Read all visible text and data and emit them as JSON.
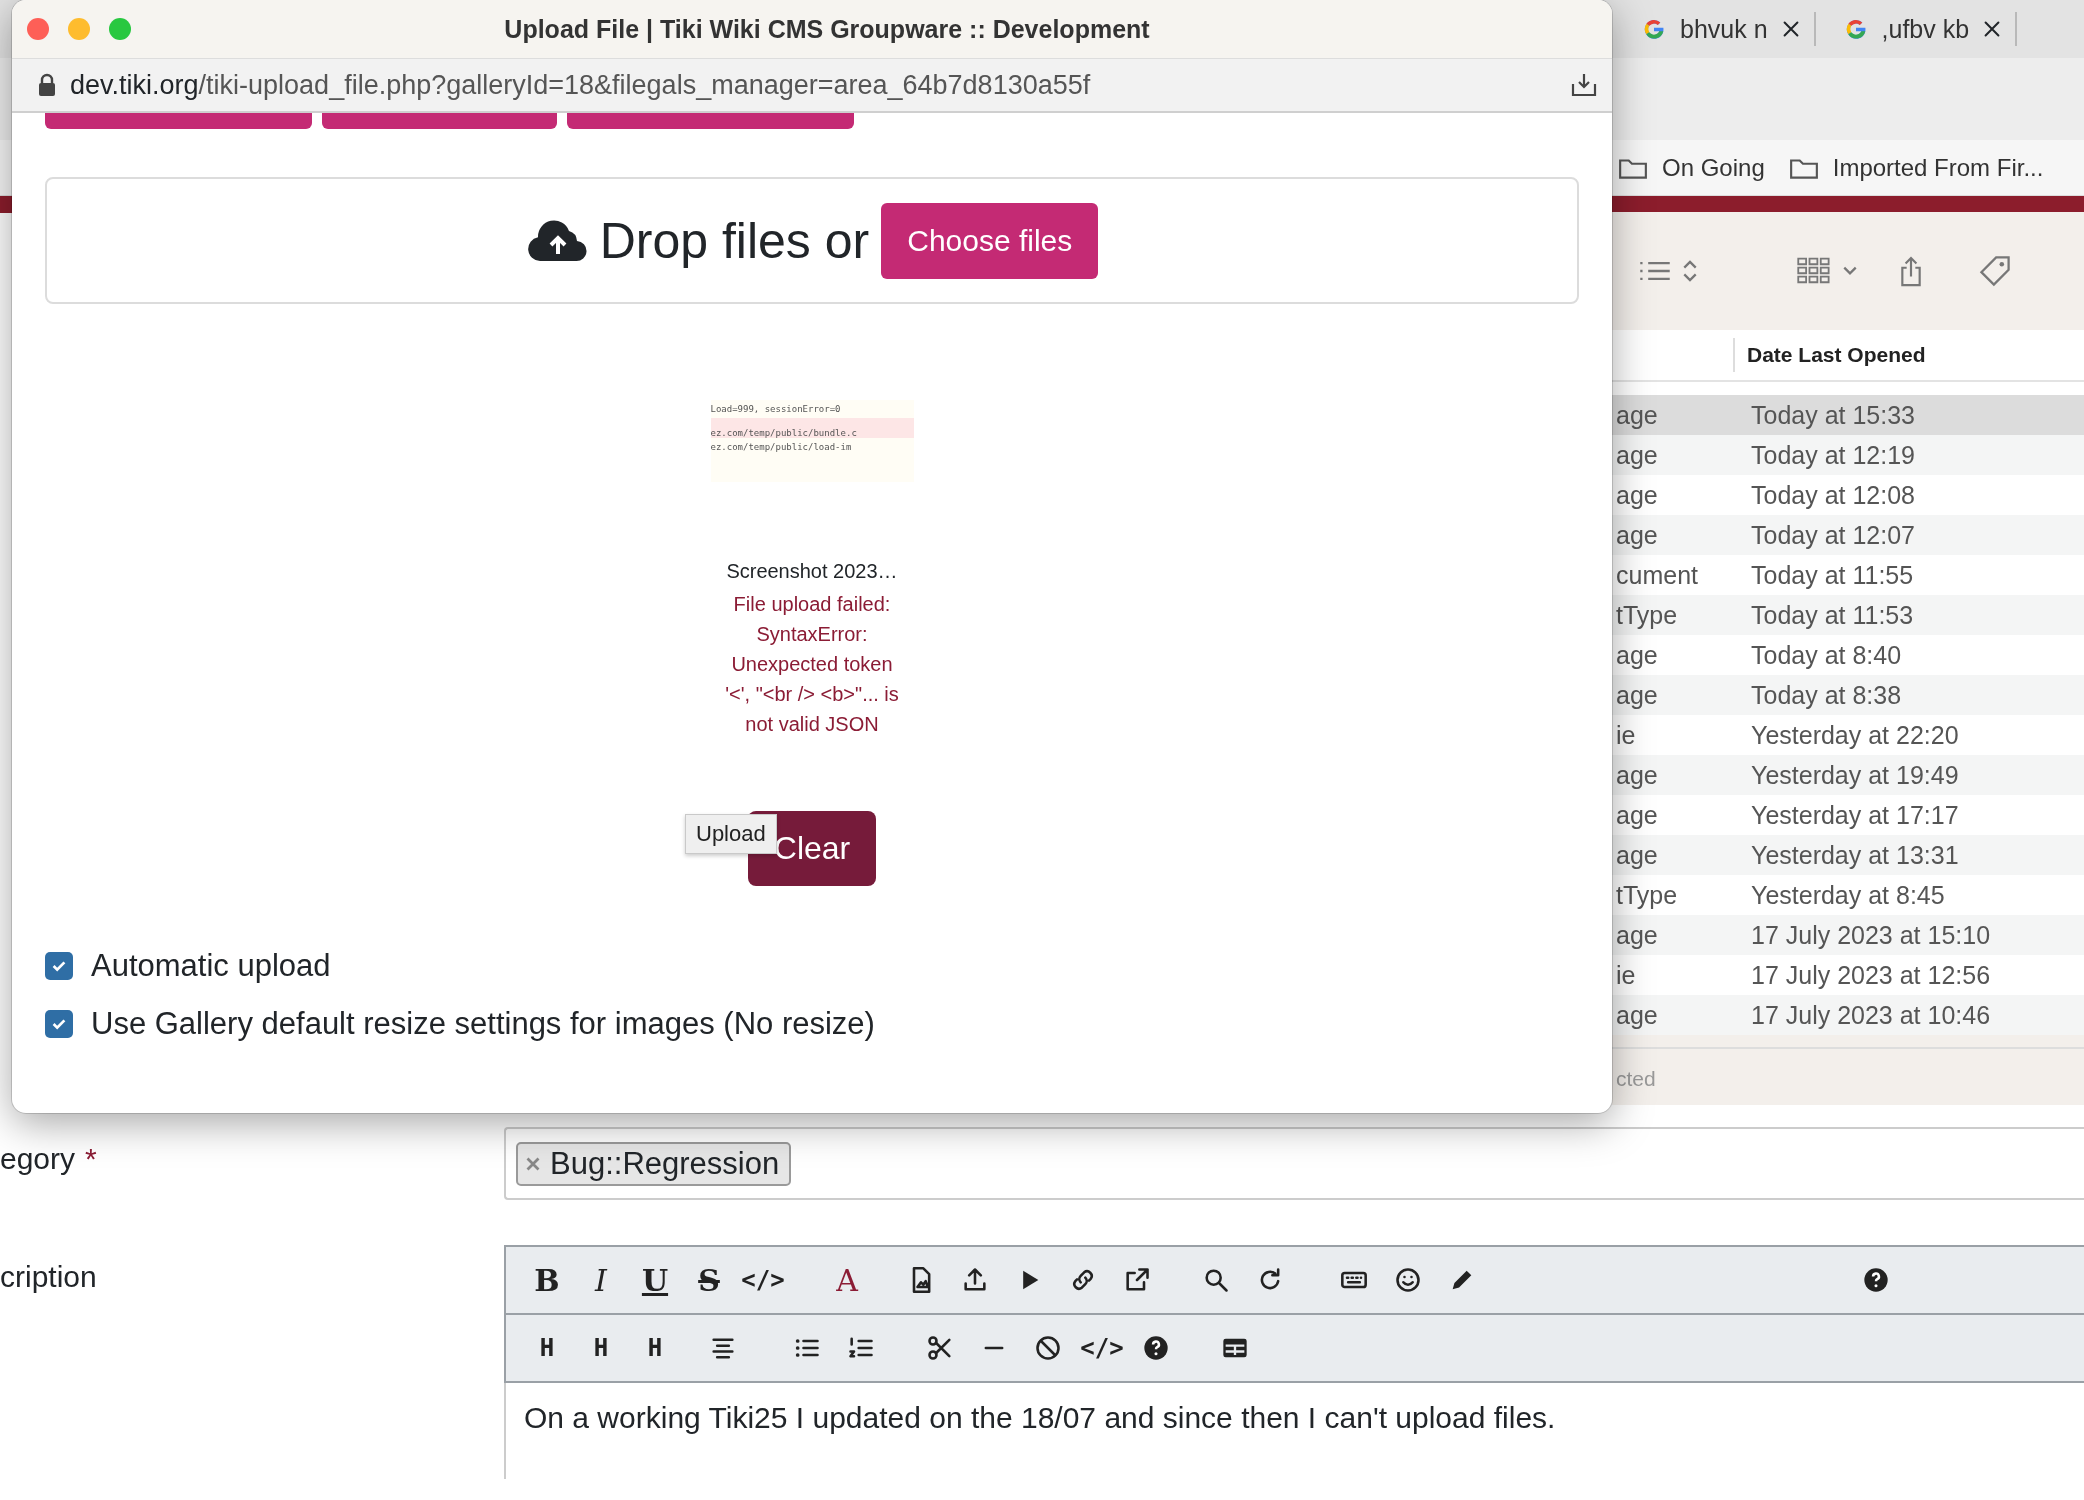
{
  "popup": {
    "title": "Upload File | Tiki Wiki CMS Groupware :: Development",
    "url_host": "dev.tiki.org",
    "url_path": "/tiki-upload_file.php?galleryId=18&filegals_manager=area_64b7d8130a55f",
    "dropzone": {
      "text": "Drop files or",
      "button": "Choose files"
    },
    "thumbnail_lines": [
      "Load=999, sessionError=0",
      "ez.com/temp/public/bundle.c",
      "ez.com/temp/public/load-im"
    ],
    "file_name": "Screenshot 2023…",
    "error": "File upload failed: SyntaxError: Unexpected token '<', \"<br /> <b>\"... is not valid JSON",
    "clear_button": "Clear",
    "tooltip": "Upload",
    "options": [
      {
        "label": "Automatic upload",
        "checked": true
      },
      {
        "label": "Use Gallery default resize settings for images (No resize)",
        "checked": true
      }
    ]
  },
  "browser_tabs": [
    {
      "title": "bhvuk n"
    },
    {
      "title": ",ufbv kb"
    }
  ],
  "bookmarks": [
    "On Going",
    "Imported From Fir..."
  ],
  "finder": {
    "column_header": "Date Last Opened",
    "footer": "cted",
    "rows": [
      {
        "column_1": "age",
        "date": "Today at 15:33",
        "selected": true
      },
      {
        "column_1": "age",
        "date": "Today at 12:19",
        "selected": false
      },
      {
        "column_1": "age",
        "date": "Today at 12:08",
        "selected": false
      },
      {
        "column_1": "age",
        "date": "Today at 12:07",
        "selected": false
      },
      {
        "column_1": "cument",
        "date": "Today at 11:55",
        "selected": false
      },
      {
        "column_1": "tType",
        "date": "Today at 11:53",
        "selected": false
      },
      {
        "column_1": "age",
        "date": "Today at 8:40",
        "selected": false
      },
      {
        "column_1": "age",
        "date": "Today at 8:38",
        "selected": false
      },
      {
        "column_1": "ie",
        "date": "Yesterday at 22:20",
        "selected": false
      },
      {
        "column_1": "age",
        "date": "Yesterday at 19:49",
        "selected": false
      },
      {
        "column_1": "age",
        "date": "Yesterday at 17:17",
        "selected": false
      },
      {
        "column_1": "age",
        "date": "Yesterday at 13:31",
        "selected": false
      },
      {
        "column_1": "tType",
        "date": "Yesterday at 8:45",
        "selected": false
      },
      {
        "column_1": "age",
        "date": "17 July 2023 at 15:10",
        "selected": false
      },
      {
        "column_1": "ie",
        "date": "17 July 2023 at 12:56",
        "selected": false
      },
      {
        "column_1": "age",
        "date": "17 July 2023 at 10:46",
        "selected": false
      }
    ]
  },
  "form": {
    "category_label": "egory",
    "required_mark": "*",
    "category_tag": "Bug::Regression",
    "description_label": "cription",
    "toolbar_rows": [
      [
        {
          "kind": "glyph",
          "text": "B"
        },
        {
          "kind": "glyph",
          "text": "I"
        },
        {
          "kind": "glyph",
          "text": "U"
        },
        {
          "kind": "glyph",
          "text": "S"
        },
        {
          "kind": "glyph",
          "text": "</>"
        },
        {
          "kind": "glyph",
          "text": "A"
        },
        {
          "kind": "icon"
        },
        {
          "kind": "icon"
        },
        {
          "kind": "icon"
        },
        {
          "kind": "icon"
        },
        {
          "kind": "icon"
        },
        {
          "kind": "icon"
        },
        {
          "kind": "icon"
        },
        {
          "kind": "icon"
        },
        {
          "kind": "icon"
        },
        {
          "kind": "icon"
        },
        {
          "kind": "icon"
        }
      ],
      [
        {
          "kind": "glyph",
          "text": "H"
        },
        {
          "kind": "glyph",
          "text": "H"
        },
        {
          "kind": "glyph",
          "text": "H"
        },
        {
          "kind": "icon"
        },
        {
          "kind": "icon"
        },
        {
          "kind": "icon"
        },
        {
          "kind": "icon"
        },
        {
          "kind": "icon"
        },
        {
          "kind": "icon"
        },
        {
          "kind": "glyph",
          "text": "</>"
        },
        {
          "kind": "icon"
        },
        {
          "kind": "icon"
        }
      ]
    ],
    "description": "On a working Tiki25 I updated on the 18/07 and since then I can't upload files."
  }
}
